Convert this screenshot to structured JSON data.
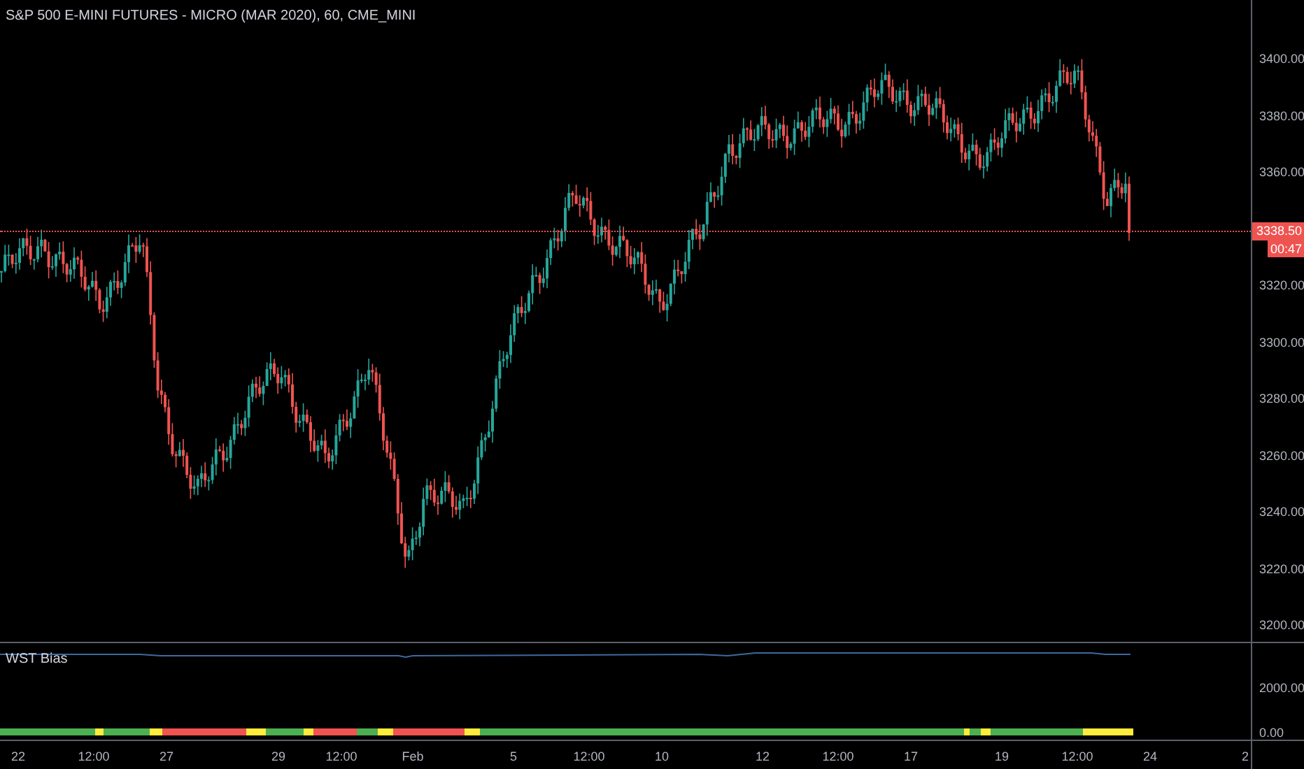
{
  "chart": {
    "title": "S&P 500 E-MINI FUTURES - MICRO (MAR 2020), 60, CME_MINI",
    "price_axis": [
      "3400.00",
      "3380.00",
      "3360.00",
      "3320.00",
      "3300.00",
      "3280.00",
      "3260.00",
      "3240.00",
      "3220.00",
      "3200.00"
    ],
    "last_price": "3338.50",
    "countdown": "00:47"
  },
  "indicator": {
    "name": "WST Bias",
    "axis": [
      "2000.00",
      "0.00"
    ]
  },
  "time_axis": [
    "22",
    "12:00",
    "27",
    "29",
    "12:00",
    "Feb",
    "5",
    "12:00",
    "10",
    "12",
    "12:00",
    "17",
    "19",
    "12:00",
    "24",
    "2"
  ]
}
